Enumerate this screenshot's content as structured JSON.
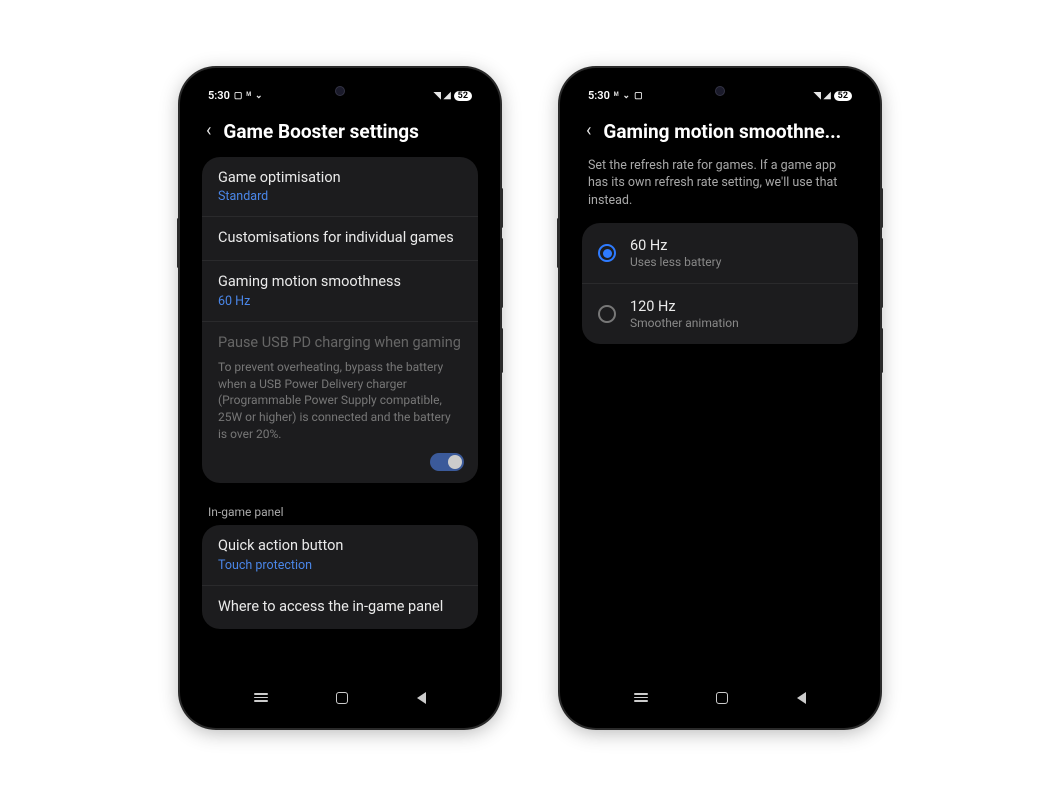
{
  "status": {
    "time": "5:30",
    "battery": "52"
  },
  "phone1": {
    "title": "Game Booster settings",
    "group1": {
      "optimisation": {
        "label": "Game optimisation",
        "value": "Standard"
      },
      "custom": {
        "label": "Customisations for individual games"
      },
      "smoothness": {
        "label": "Gaming motion smoothness",
        "value": "60 Hz"
      },
      "usbpd": {
        "label": "Pause USB PD charging when gaming",
        "desc": "To prevent overheating, bypass the battery when a USB Power Delivery charger (Programmable Power Supply compatible, 25W or higher) is connected and the battery is over 20%."
      }
    },
    "section_header": "In-game panel",
    "group2": {
      "quick": {
        "label": "Quick action button",
        "value": "Touch protection"
      },
      "where": {
        "label": "Where to access the in-game panel"
      }
    }
  },
  "phone2": {
    "title": "Gaming motion smoothne...",
    "description": "Set the refresh rate for games. If a game app has its own refresh rate setting, we'll use that instead.",
    "options": {
      "opt60": {
        "label": "60 Hz",
        "sub": "Uses less battery",
        "selected": true
      },
      "opt120": {
        "label": "120 Hz",
        "sub": "Smoother animation",
        "selected": false
      }
    }
  }
}
